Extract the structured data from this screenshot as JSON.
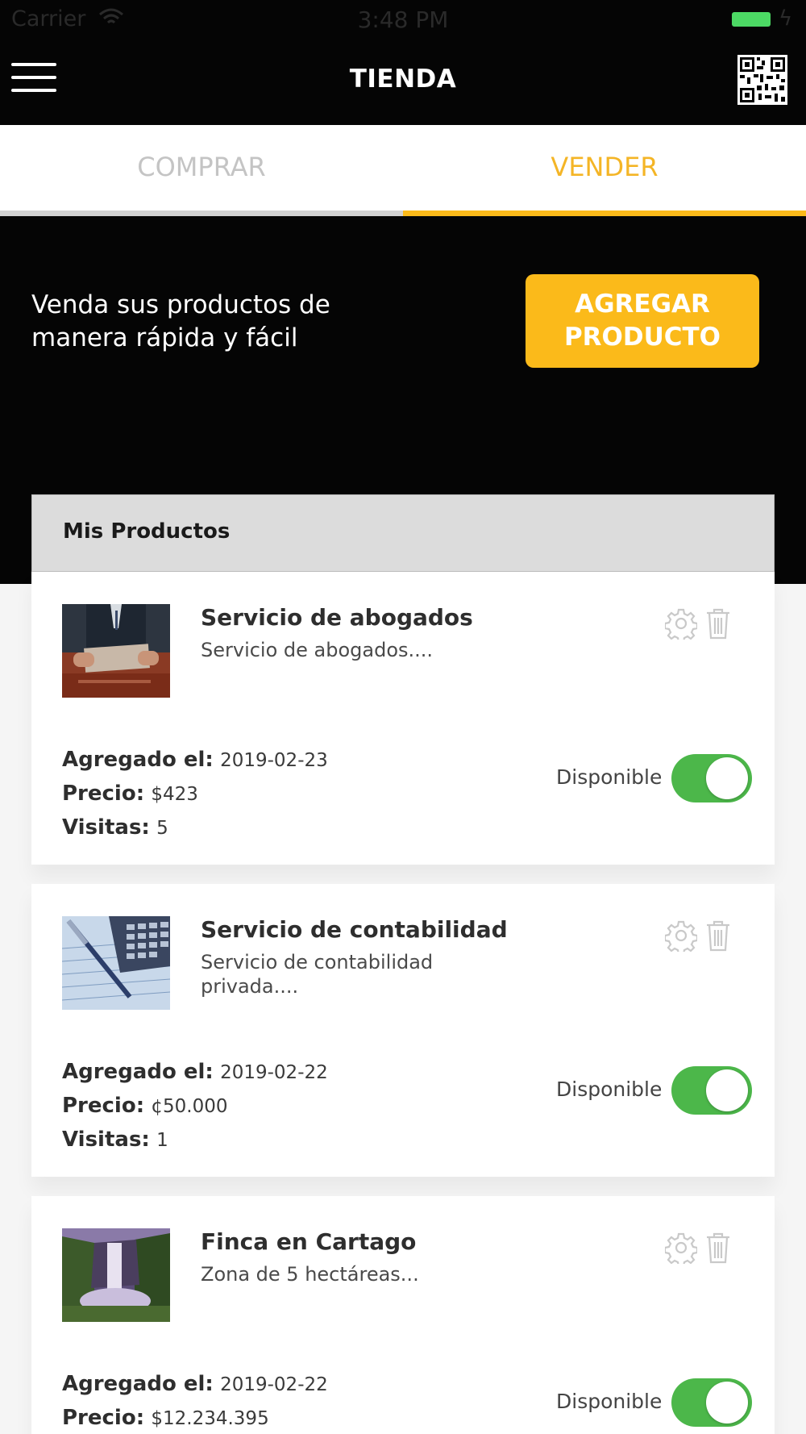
{
  "status_bar": {
    "carrier": "Carrier",
    "time": "3:48 PM"
  },
  "nav": {
    "title": "TIENDA",
    "menu_icon": "hamburger-menu-icon",
    "qr_icon": "qr-code-icon"
  },
  "tabs": [
    {
      "label": "COMPRAR",
      "active": false
    },
    {
      "label": "VENDER",
      "active": true
    }
  ],
  "hero": {
    "text_line1": "Venda sus productos de",
    "text_line2": "manera rápida y fácil",
    "button_line1": "AGREGAR",
    "button_line2": "PRODUCTO"
  },
  "products_section": {
    "title": "Mis Productos"
  },
  "labels": {
    "added": "Agregado el:",
    "price": "Precio:",
    "visits": "Visitas:",
    "available": "Disponible"
  },
  "products": [
    {
      "title": "Servicio de abogados",
      "description": "Servicio de abogados....",
      "date": "2019-02-23",
      "price": "$423",
      "visits": "5",
      "available": true,
      "image_icon": "lawyer-laptop-photo"
    },
    {
      "title": "Servicio de contabilidad",
      "description": "Servicio de contabilidad privada....",
      "date": "2019-02-22",
      "price": "¢50.000",
      "visits": "1",
      "available": true,
      "image_icon": "calculator-pen-photo"
    },
    {
      "title": "Finca en Cartago",
      "description": "Zona de 5 hectáreas...",
      "date": "2019-02-22",
      "price": "$12.234.395",
      "visits": "",
      "available": true,
      "image_icon": "waterfall-photo"
    }
  ],
  "colors": {
    "accent": "#fbba1a",
    "toggle_on": "#4cb74a",
    "header_bg": "#050505"
  }
}
